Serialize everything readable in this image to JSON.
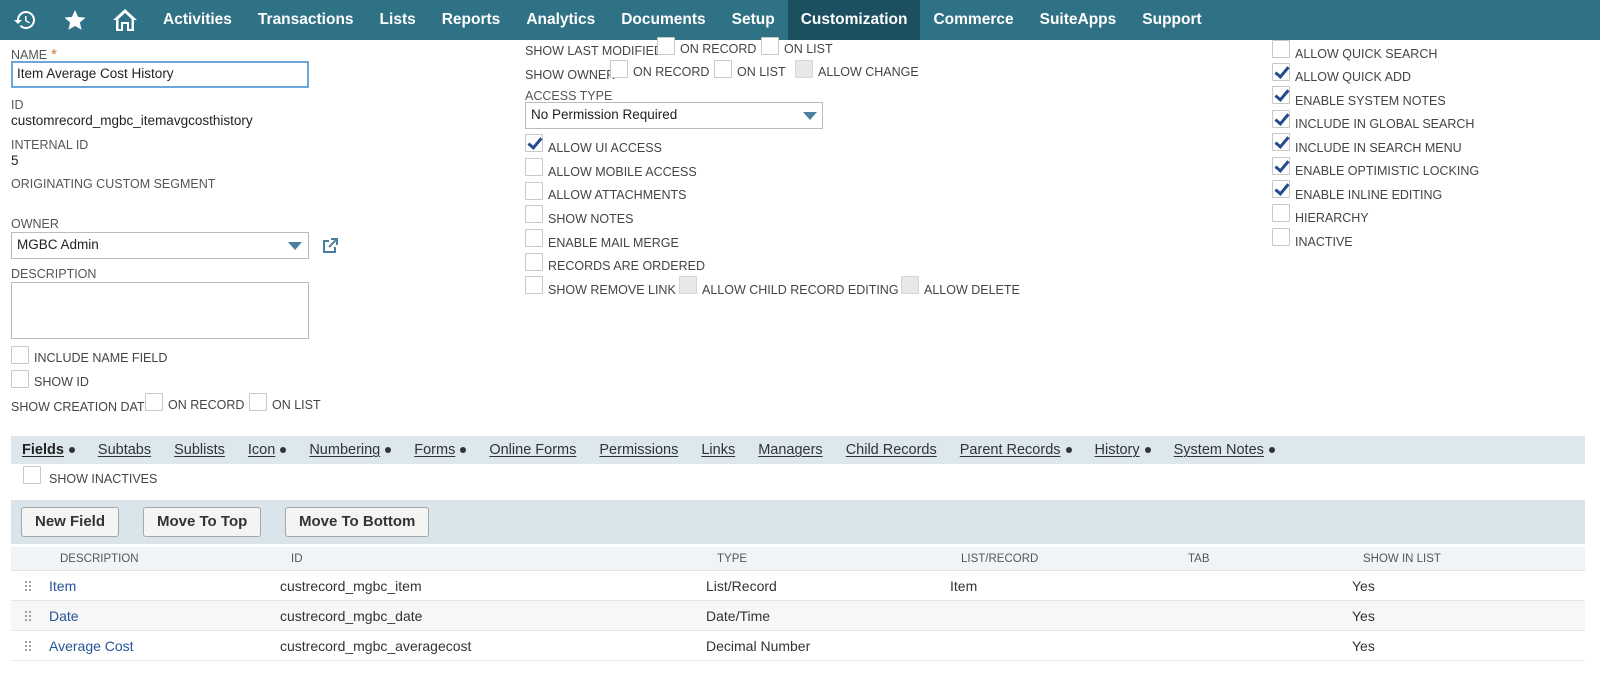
{
  "nav": {
    "items": [
      "Activities",
      "Transactions",
      "Lists",
      "Reports",
      "Analytics",
      "Documents",
      "Setup",
      "Customization",
      "Commerce",
      "SuiteApps",
      "Support"
    ],
    "active": "Customization",
    "icons": [
      "recent-records-icon",
      "favorites-star-icon",
      "home-icon"
    ]
  },
  "form": {
    "name_label": "NAME",
    "required_mark": "*",
    "name_value": "Item Average Cost History",
    "id_label": "ID",
    "id_value": "customrecord_mgbc_itemavgcosthistory",
    "internal_id_label": "INTERNAL ID",
    "internal_id_value": "5",
    "originating_label": "ORIGINATING CUSTOM SEGMENT",
    "owner_label": "OWNER",
    "owner_value": "MGBC Admin",
    "description_label": "DESCRIPTION",
    "include_name_field": "INCLUDE NAME FIELD",
    "show_id": "SHOW ID",
    "show_creation_date": "SHOW CREATION DATE",
    "on_record": "ON RECORD",
    "on_list": "ON LIST"
  },
  "middle": {
    "show_last_modified": "SHOW LAST MODIFIED",
    "show_owner": "SHOW OWNER",
    "on_record": "ON RECORD",
    "on_list": "ON LIST",
    "allow_change": "ALLOW CHANGE",
    "access_type_label": "ACCESS TYPE",
    "access_type_value": "No Permission Required",
    "allow_ui_access": "ALLOW UI ACCESS",
    "allow_mobile_access": "ALLOW MOBILE ACCESS",
    "allow_attachments": "ALLOW ATTACHMENTS",
    "show_notes": "SHOW NOTES",
    "enable_mail_merge": "ENABLE MAIL MERGE",
    "records_are_ordered": "RECORDS ARE ORDERED",
    "show_remove_link": "SHOW REMOVE LINK",
    "allow_child_record_editing": "ALLOW CHILD RECORD EDITING",
    "allow_delete": "ALLOW DELETE"
  },
  "right": {
    "allow_quick_search": "ALLOW QUICK SEARCH",
    "allow_quick_add": "ALLOW QUICK ADD",
    "enable_system_notes": "ENABLE SYSTEM NOTES",
    "include_in_global_search": "INCLUDE IN GLOBAL SEARCH",
    "include_in_search_menu": "INCLUDE IN SEARCH MENU",
    "enable_optimistic_locking": "ENABLE OPTIMISTIC LOCKING",
    "enable_inline_editing": "ENABLE INLINE EDITING",
    "hierarchy": "HIERARCHY",
    "inactive": "INACTIVE"
  },
  "subtabs": [
    {
      "label": "Fields",
      "dot": true
    },
    {
      "label": "Subtabs",
      "dot": false
    },
    {
      "label": "Sublists",
      "dot": false
    },
    {
      "label": "Icon",
      "dot": true
    },
    {
      "label": "Numbering",
      "dot": true
    },
    {
      "label": "Forms",
      "dot": true
    },
    {
      "label": "Online Forms",
      "dot": false
    },
    {
      "label": "Permissions",
      "dot": false
    },
    {
      "label": "Links",
      "dot": false
    },
    {
      "label": "Managers",
      "dot": false
    },
    {
      "label": "Child Records",
      "dot": false
    },
    {
      "label": "Parent Records",
      "dot": true
    },
    {
      "label": "History",
      "dot": true
    },
    {
      "label": "System Notes",
      "dot": true
    }
  ],
  "fields_tab": {
    "show_inactives": "SHOW INACTIVES",
    "buttons": {
      "new_field": "New Field",
      "move_to_top": "Move To Top",
      "move_to_bottom": "Move To Bottom"
    },
    "columns": {
      "description": "DESCRIPTION",
      "id": "ID",
      "type": "TYPE",
      "list_record": "LIST/RECORD",
      "tab": "TAB",
      "show_in_list": "SHOW IN LIST"
    },
    "rows": [
      {
        "description": "Item",
        "id": "custrecord_mgbc_item",
        "type": "List/Record",
        "list_record": "Item",
        "tab": "",
        "show_in_list": "Yes"
      },
      {
        "description": "Date",
        "id": "custrecord_mgbc_date",
        "type": "Date/Time",
        "list_record": "",
        "tab": "",
        "show_in_list": "Yes"
      },
      {
        "description": "Average Cost",
        "id": "custrecord_mgbc_averagecost",
        "type": "Decimal Number",
        "list_record": "",
        "tab": "",
        "show_in_list": "Yes"
      }
    ]
  }
}
